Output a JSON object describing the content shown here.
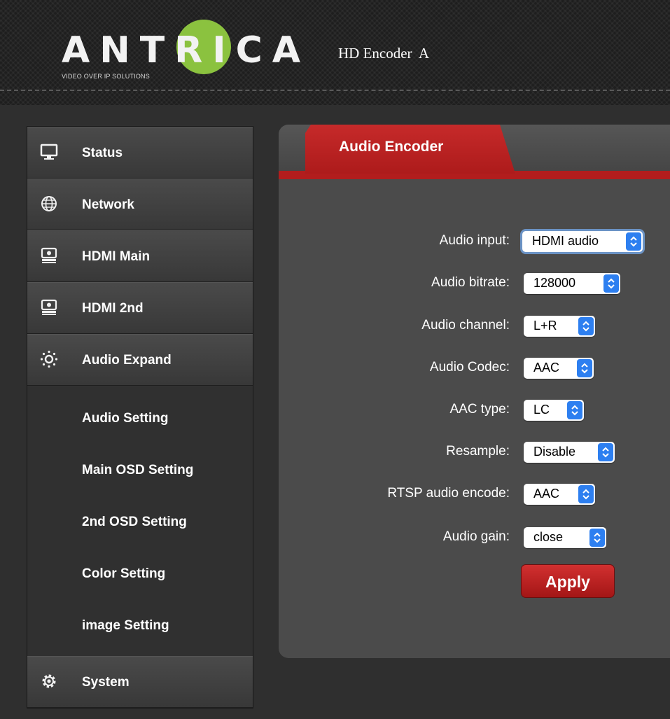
{
  "header": {
    "logo_text": "ANTRICA",
    "logo_tagline": "VIDEO OVER IP SOLUTIONS",
    "title": "HD Encoder  A"
  },
  "sidebar": {
    "items": [
      {
        "label": "Status",
        "icon": "monitor-icon"
      },
      {
        "label": "Network",
        "icon": "globe-icon"
      },
      {
        "label": "HDMI Main",
        "icon": "hdmi-icon"
      },
      {
        "label": "HDMI 2nd",
        "icon": "hdmi-icon"
      },
      {
        "label": "Audio Expand",
        "icon": "sun-icon"
      }
    ],
    "subitems": [
      {
        "label": "Audio Setting"
      },
      {
        "label": "Main OSD Setting"
      },
      {
        "label": "2nd OSD Setting"
      },
      {
        "label": "Color Setting"
      },
      {
        "label": "image Setting"
      }
    ],
    "system": {
      "label": "System",
      "icon": "gear-icon"
    }
  },
  "panel": {
    "tab_label": "Audio Encoder",
    "fields": [
      {
        "label": "Audio input:",
        "value": "HDMI audio"
      },
      {
        "label": "Audio bitrate:",
        "value": "128000"
      },
      {
        "label": "Audio channel:",
        "value": "L+R"
      },
      {
        "label": "Audio Codec:",
        "value": "AAC"
      },
      {
        "label": "AAC type:",
        "value": "LC"
      },
      {
        "label": "Resample:",
        "value": "Disable"
      },
      {
        "label": "RTSP audio encode:",
        "value": "AAC"
      },
      {
        "label": "Audio gain:",
        "value": "close"
      }
    ],
    "apply_label": "Apply"
  },
  "colors": {
    "accent_red": "#b21d1d",
    "logo_green": "#8bc23f",
    "select_arrow_blue": "#2d7ff0"
  }
}
